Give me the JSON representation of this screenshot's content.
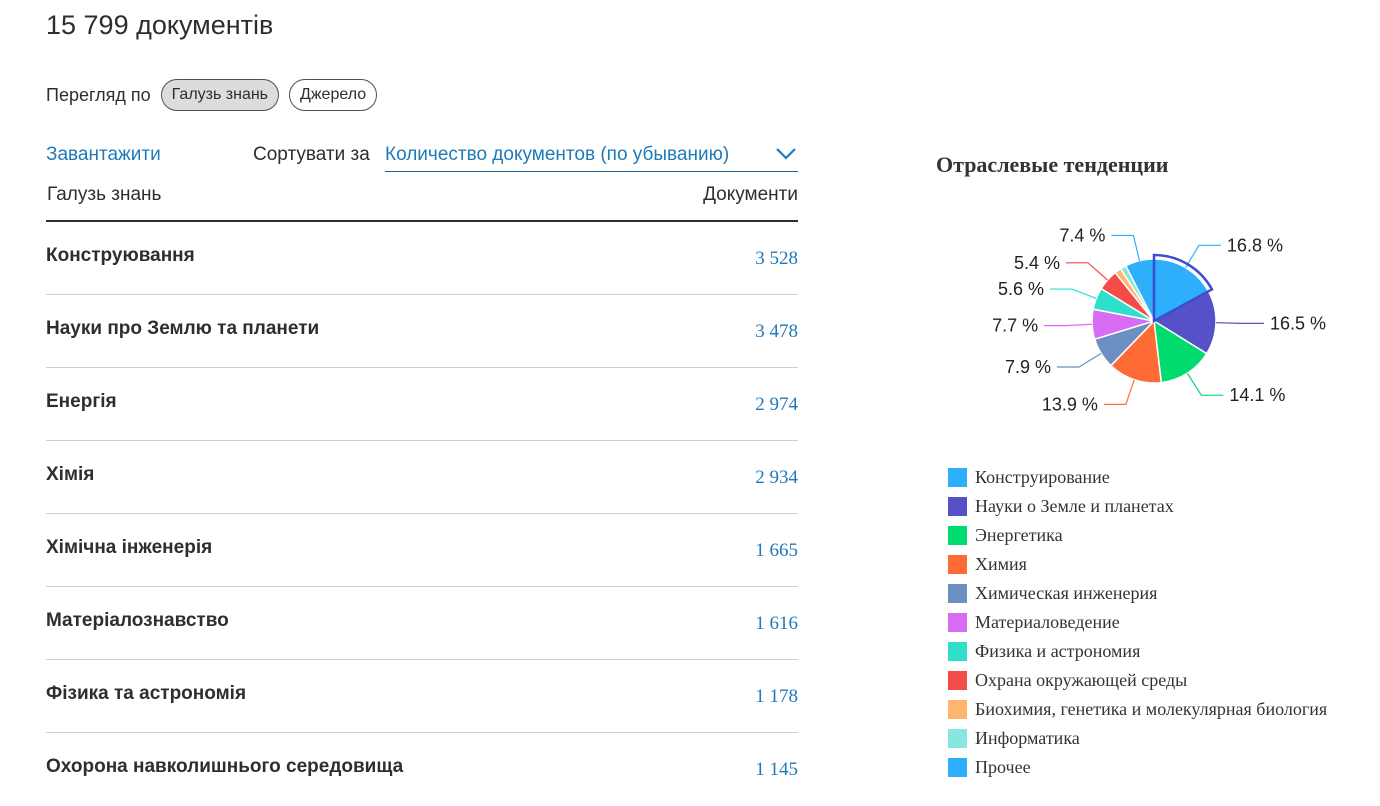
{
  "header": {
    "doc_count": "15 799 документів"
  },
  "view_by": {
    "label": "Перегляд по",
    "options": [
      {
        "label": "Галузь знань",
        "active": true
      },
      {
        "label": "Джерело",
        "active": false
      }
    ]
  },
  "toolbar": {
    "download": "Завантажити",
    "sort_label": "Сортувати за",
    "sort_value": "Количество документов (по убыванию)",
    "sort_icon": "chevron-down-icon"
  },
  "table": {
    "headers": {
      "field": "Галузь знань",
      "docs": "Документи"
    },
    "rows": [
      {
        "label": "Конструювання",
        "count": "3 528"
      },
      {
        "label": "Науки про Землю та планети",
        "count": "3 478"
      },
      {
        "label": "Енергія",
        "count": "2 974"
      },
      {
        "label": "Хімія",
        "count": "2 934"
      },
      {
        "label": "Хімічна інженерія",
        "count": "1 665"
      },
      {
        "label": "Матеріалознавство",
        "count": "1 616"
      },
      {
        "label": "Фізика та астрономія",
        "count": "1 178"
      },
      {
        "label": "Охорона навколишнього середовища",
        "count": "1 145"
      }
    ]
  },
  "chart_data": {
    "type": "pie",
    "title": "Отраслевые тенденции",
    "legend_position": "bottom",
    "slices": [
      {
        "label": "Конструирование",
        "percent": 16.8,
        "color": "#2eaffb",
        "value_label": "16.8 %",
        "highlighted": true
      },
      {
        "label": "Науки о Земле и планетах",
        "percent": 16.5,
        "color": "#5650c9",
        "value_label": "16.5 %"
      },
      {
        "label": "Энергетика",
        "percent": 14.1,
        "color": "#00db6f",
        "value_label": "14.1 %"
      },
      {
        "label": "Химия",
        "percent": 13.9,
        "color": "#ff6b35",
        "value_label": "13.9 %"
      },
      {
        "label": "Химическая инженерия",
        "percent": 7.9,
        "color": "#6b8fc0",
        "value_label": "7.9 %"
      },
      {
        "label": "Материаловедение",
        "percent": 7.7,
        "color": "#d86cf5",
        "value_label": "7.7 %"
      },
      {
        "label": "Физика и астрономия",
        "percent": 5.6,
        "color": "#2ee0cc",
        "value_label": "5.6 %"
      },
      {
        "label": "Охрана окружающей среды",
        "percent": 5.4,
        "color": "#f44b4b",
        "value_label": "5.4 %"
      },
      {
        "label": "Биохимия, генетика и молекулярная биология",
        "percent": 1.7,
        "color": "#ffb56b",
        "value_label": ""
      },
      {
        "label": "Информатика",
        "percent": 1.5,
        "color": "#88e6dc",
        "value_label": ""
      },
      {
        "label": "Прочее",
        "percent": 7.4,
        "color": "#2eaffb",
        "value_label": "7.4 %"
      }
    ]
  }
}
